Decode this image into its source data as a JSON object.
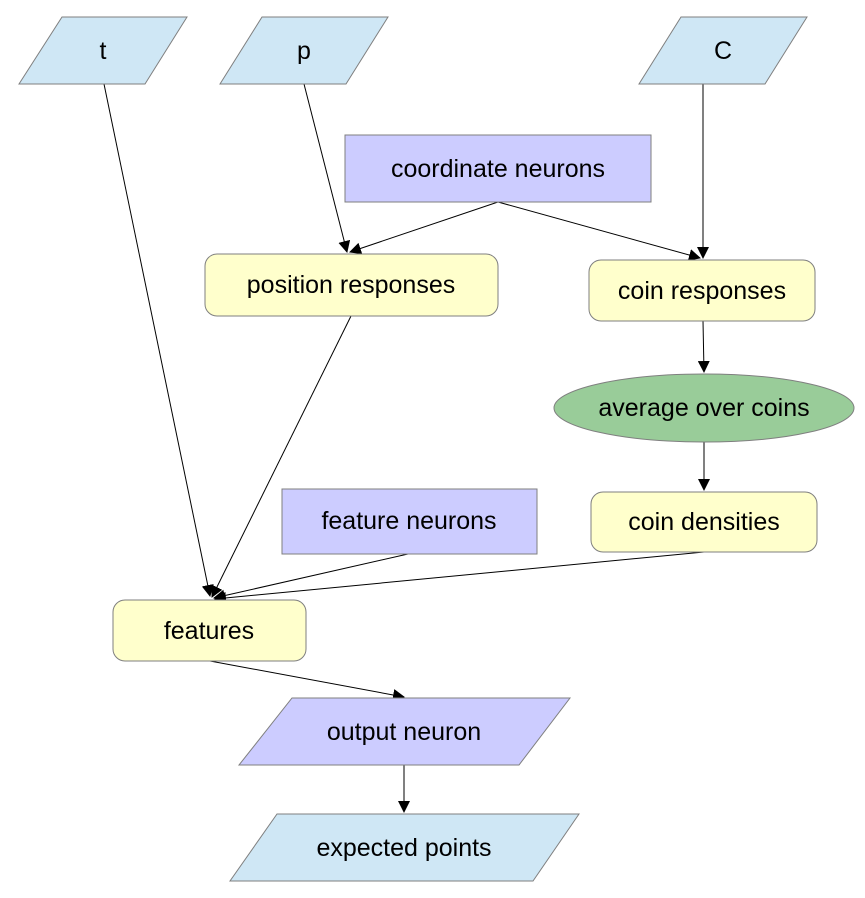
{
  "colors": {
    "input_fill": "#cfe7f5",
    "neuron_fill": "#ccccff",
    "process_fill": "#ffffcc",
    "operation_fill": "#99cc99",
    "edge": "#000000"
  },
  "nodes": {
    "t": {
      "label": "t",
      "kind": "input"
    },
    "p": {
      "label": "p",
      "kind": "input"
    },
    "C": {
      "label": "C",
      "kind": "input"
    },
    "coordinate_neurons": {
      "label": "coordinate neurons",
      "kind": "neuron"
    },
    "position_responses": {
      "label": "position responses",
      "kind": "process"
    },
    "coin_responses": {
      "label": "coin responses",
      "kind": "process"
    },
    "average_over_coins": {
      "label": "average over coins",
      "kind": "operation"
    },
    "coin_densities": {
      "label": "coin densities",
      "kind": "process"
    },
    "feature_neurons": {
      "label": "feature neurons",
      "kind": "neuron"
    },
    "features": {
      "label": "features",
      "kind": "process"
    },
    "output_neuron": {
      "label": "output neuron",
      "kind": "neuron-io"
    },
    "expected_points": {
      "label": "expected points",
      "kind": "input"
    }
  },
  "edges": [
    {
      "from": "t",
      "to": "features"
    },
    {
      "from": "p",
      "to": "position_responses"
    },
    {
      "from": "coordinate_neurons",
      "to": "position_responses"
    },
    {
      "from": "coordinate_neurons",
      "to": "coin_responses"
    },
    {
      "from": "C",
      "to": "coin_responses"
    },
    {
      "from": "coin_responses",
      "to": "average_over_coins"
    },
    {
      "from": "average_over_coins",
      "to": "coin_densities"
    },
    {
      "from": "position_responses",
      "to": "features"
    },
    {
      "from": "feature_neurons",
      "to": "features"
    },
    {
      "from": "coin_densities",
      "to": "features"
    },
    {
      "from": "features",
      "to": "output_neuron"
    },
    {
      "from": "output_neuron",
      "to": "expected_points"
    }
  ]
}
